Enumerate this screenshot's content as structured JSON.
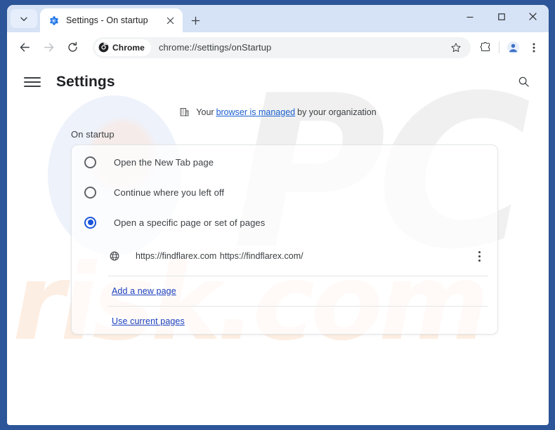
{
  "window": {
    "controls": {
      "minimize_label": "Minimize",
      "maximize_label": "Maximize",
      "close_label": "Close"
    }
  },
  "tabstrip": {
    "tab_search_name": "Search tabs",
    "tab": {
      "favicon": "settings-gear-icon",
      "title": "Settings - On startup",
      "close_label": "Close tab"
    },
    "new_tab_label": "New Tab"
  },
  "toolbar": {
    "back_label": "Back",
    "forward_label": "Forward",
    "reload_label": "Reload",
    "chrome_chip_label": "Chrome",
    "url": "chrome://settings/onStartup",
    "bookmark_label": "Bookmark this tab",
    "extensions_label": "Extensions",
    "profile_label": "Profile",
    "menu_label": "Customize and control Google Chrome"
  },
  "settings": {
    "menu_label": "Main menu",
    "title": "Settings",
    "search_label": "Search settings",
    "managed": {
      "pre": "Your",
      "link": "browser is managed",
      "post": "by your organization"
    },
    "section_label": "On startup",
    "options": [
      {
        "label": "Open the New Tab page",
        "selected": false
      },
      {
        "label": "Continue where you left off",
        "selected": false
      },
      {
        "label": "Open a specific page or set of pages",
        "selected": true
      }
    ],
    "startup_page": {
      "title": "https://findflarex.com",
      "url": "https://findflarex.com/",
      "menu_label": "More actions"
    },
    "links": {
      "add_new_page": "Add a new page",
      "use_current_pages": "Use current pages"
    }
  },
  "watermark": {
    "big": "PC",
    "small": "risk.com"
  },
  "colors": {
    "frame": "#2c5699",
    "tabstrip": "#d6e2f5",
    "accent": "#1a56db",
    "link": "#1a3fbd",
    "managed_link": "#1a5fd0",
    "text": "#3c4043"
  }
}
